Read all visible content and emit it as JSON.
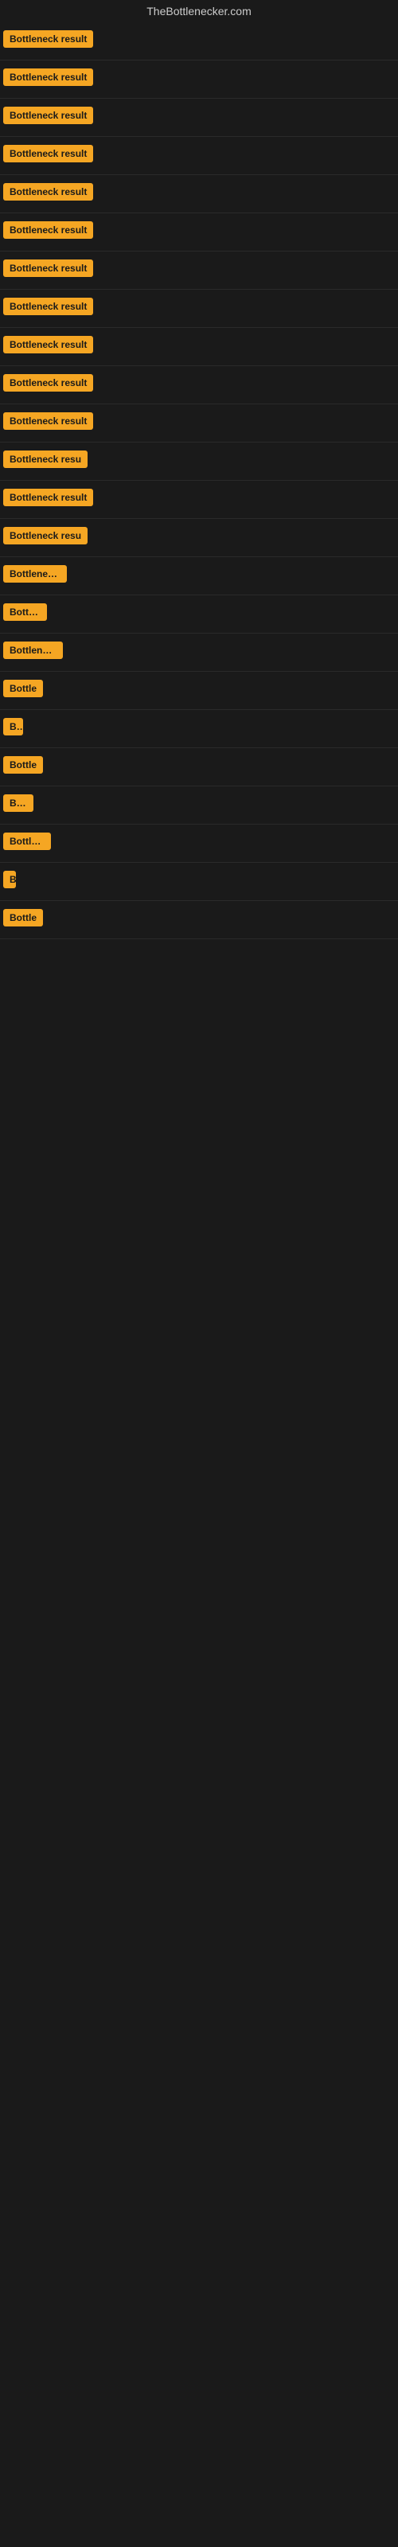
{
  "site": {
    "title": "TheBottlenecker.com"
  },
  "badges": [
    {
      "id": 1,
      "label": "Bottleneck result",
      "truncated": false
    },
    {
      "id": 2,
      "label": "Bottleneck result",
      "truncated": false
    },
    {
      "id": 3,
      "label": "Bottleneck result",
      "truncated": false
    },
    {
      "id": 4,
      "label": "Bottleneck result",
      "truncated": false
    },
    {
      "id": 5,
      "label": "Bottleneck result",
      "truncated": false
    },
    {
      "id": 6,
      "label": "Bottleneck result",
      "truncated": false
    },
    {
      "id": 7,
      "label": "Bottleneck result",
      "truncated": false
    },
    {
      "id": 8,
      "label": "Bottleneck result",
      "truncated": false
    },
    {
      "id": 9,
      "label": "Bottleneck result",
      "truncated": false
    },
    {
      "id": 10,
      "label": "Bottleneck result",
      "truncated": false
    },
    {
      "id": 11,
      "label": "Bottleneck result",
      "truncated": false
    },
    {
      "id": 12,
      "label": "Bottleneck resu",
      "truncated": true
    },
    {
      "id": 13,
      "label": "Bottleneck result",
      "truncated": false
    },
    {
      "id": 14,
      "label": "Bottleneck resu",
      "truncated": true
    },
    {
      "id": 15,
      "label": "Bottleneck r",
      "truncated": true
    },
    {
      "id": 16,
      "label": "Bottlen",
      "truncated": true
    },
    {
      "id": 17,
      "label": "Bottleneck",
      "truncated": true
    },
    {
      "id": 18,
      "label": "Bottle",
      "truncated": true
    },
    {
      "id": 19,
      "label": "Bo",
      "truncated": true
    },
    {
      "id": 20,
      "label": "Bottle",
      "truncated": true
    },
    {
      "id": 21,
      "label": "Bott",
      "truncated": true
    },
    {
      "id": 22,
      "label": "Bottlens",
      "truncated": true
    },
    {
      "id": 23,
      "label": "B",
      "truncated": true
    },
    {
      "id": 24,
      "label": "Bottle",
      "truncated": true
    }
  ]
}
